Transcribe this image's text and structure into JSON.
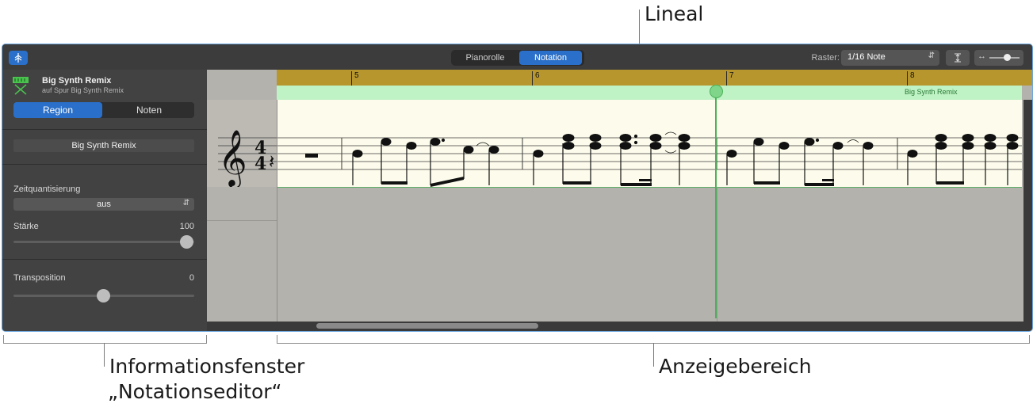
{
  "callouts": {
    "ruler": "Lineal",
    "inspector_line1": "Informationsfenster",
    "inspector_line2": "„Notationseditor“",
    "display_area": "Anzeigebereich"
  },
  "toolbar": {
    "tabs": [
      "Pianorolle",
      "Notation"
    ],
    "active_tab": "Notation",
    "grid_label": "Raster:",
    "grid_value": "1/16 Note"
  },
  "inspector": {
    "region_title": "Big Synth Remix",
    "region_subtitle": "auf Spur Big Synth Remix",
    "tabs": [
      "Region",
      "Noten"
    ],
    "active_tab": "Region",
    "region_name_field": "Big Synth Remix",
    "quantize_label": "Zeitquantisierung",
    "quantize_value": "aus",
    "velocity_label": "Stärke",
    "velocity_value": "100",
    "transpose_label": "Transposition",
    "transpose_value": "0"
  },
  "ruler": {
    "bars": [
      "5",
      "6",
      "7",
      "8"
    ],
    "region_name": "Big Synth Remix"
  },
  "colors": {
    "ruler_gold": "#b8962e",
    "region_green": "#bff2c4",
    "staff_bg": "#fdfcec",
    "playhead": "#4cb25a",
    "accent_blue": "#2a6fc9"
  }
}
